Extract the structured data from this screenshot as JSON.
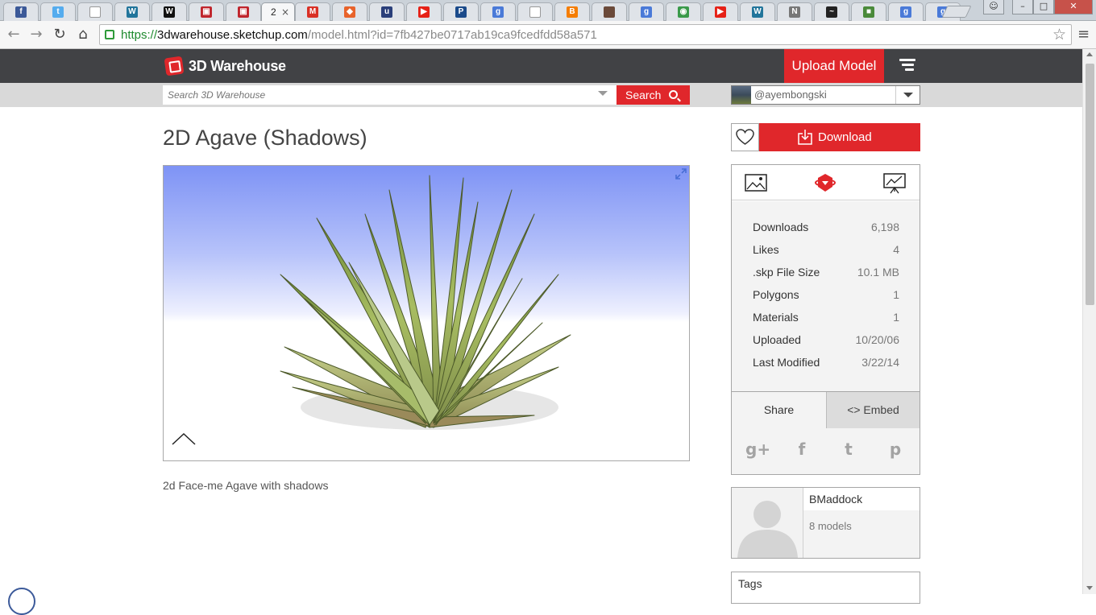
{
  "browser": {
    "tabs": [
      {
        "icon": "facebook-icon",
        "glyph": "f",
        "color": "#3b5998"
      },
      {
        "icon": "twitter-icon",
        "glyph": "t",
        "color": "#55acee"
      },
      {
        "icon": "document-icon",
        "glyph": "",
        "color": "#ffffff"
      },
      {
        "icon": "wordpress-icon",
        "glyph": "W",
        "color": "#21759b"
      },
      {
        "icon": "w-app-icon",
        "glyph": "W",
        "color": "#111111"
      },
      {
        "icon": "printer-icon",
        "glyph": "▣",
        "color": "#c0262d"
      },
      {
        "icon": "printer-icon",
        "glyph": "▣",
        "color": "#c0262d"
      },
      {
        "icon": "gmail-icon",
        "glyph": "M",
        "color": "#d93025"
      },
      {
        "icon": "magento-icon",
        "glyph": "◆",
        "color": "#e8632b"
      },
      {
        "icon": "unv-icon",
        "glyph": "u",
        "color": "#2a3f7a"
      },
      {
        "icon": "youtube-icon",
        "glyph": "▶",
        "color": "#e62117"
      },
      {
        "icon": "parking-icon",
        "glyph": "P",
        "color": "#1a4a8a"
      },
      {
        "icon": "google-icon",
        "glyph": "g",
        "color": "#4a7ad8"
      },
      {
        "icon": "document-icon",
        "glyph": "",
        "color": "#ffffff"
      },
      {
        "icon": "blogger-icon",
        "glyph": "B",
        "color": "#f57d00"
      },
      {
        "icon": "image-tab-icon",
        "glyph": "",
        "color": "#6b4a3a"
      },
      {
        "icon": "google-icon",
        "glyph": "g",
        "color": "#4a7ad8"
      },
      {
        "icon": "maps-icon",
        "glyph": "◉",
        "color": "#3a9a4a"
      },
      {
        "icon": "youtube-icon",
        "glyph": "▶",
        "color": "#e62117"
      },
      {
        "icon": "wordpress-icon",
        "glyph": "W",
        "color": "#21759b"
      },
      {
        "icon": "n-icon",
        "glyph": "N",
        "color": "#777777"
      },
      {
        "icon": "waveform-icon",
        "glyph": "~",
        "color": "#222222"
      },
      {
        "icon": "sketchup-icon",
        "glyph": "■",
        "color": "#4a8a3a"
      },
      {
        "icon": "google-icon",
        "glyph": "g",
        "color": "#4a7ad8"
      },
      {
        "icon": "google-icon",
        "glyph": "g",
        "color": "#4a7ad8"
      }
    ],
    "active_tab_title": "2",
    "active_tab_close": "×",
    "url_scheme": "https://",
    "url_host": "3dwarehouse.sketchup.com",
    "url_path": "/model.html?id=7fb427be0717ab19ca9fcedfdd58a571",
    "back": "←",
    "forward": "→",
    "reload": "↻",
    "home": "⌂",
    "bookmark": "☆",
    "menu": "≡",
    "win_user": "☺",
    "win_min": "–",
    "win_max": "□",
    "win_close": "✕"
  },
  "site": {
    "logo_text": "3D Warehouse",
    "upload_label": "Upload Model",
    "search_placeholder": "Search 3D Warehouse",
    "search_label": "Search",
    "username": "@ayembongski",
    "accent": "#e0272b"
  },
  "model": {
    "title": "2D Agave (Shadows)",
    "description": "2d Face-me Agave with shadows",
    "download_label": "Download",
    "stats": [
      {
        "label": "Downloads",
        "value": "6,198"
      },
      {
        "label": "Likes",
        "value": "4"
      },
      {
        "label": ".skp File Size",
        "value": "10.1 MB"
      },
      {
        "label": "Polygons",
        "value": "1"
      },
      {
        "label": "Materials",
        "value": "1"
      },
      {
        "label": "Uploaded",
        "value": "10/20/06"
      },
      {
        "label": "Last Modified",
        "value": "3/22/14"
      }
    ],
    "share_label": "Share",
    "embed_label": "<> Embed",
    "social": [
      {
        "name": "google-plus-icon",
        "glyph": "g+"
      },
      {
        "name": "facebook-icon",
        "glyph": "f"
      },
      {
        "name": "twitter-icon",
        "glyph": "t"
      },
      {
        "name": "pinterest-icon",
        "glyph": "p"
      }
    ]
  },
  "author": {
    "name": "BMaddock",
    "models": "8 models"
  },
  "tags_label": "Tags"
}
